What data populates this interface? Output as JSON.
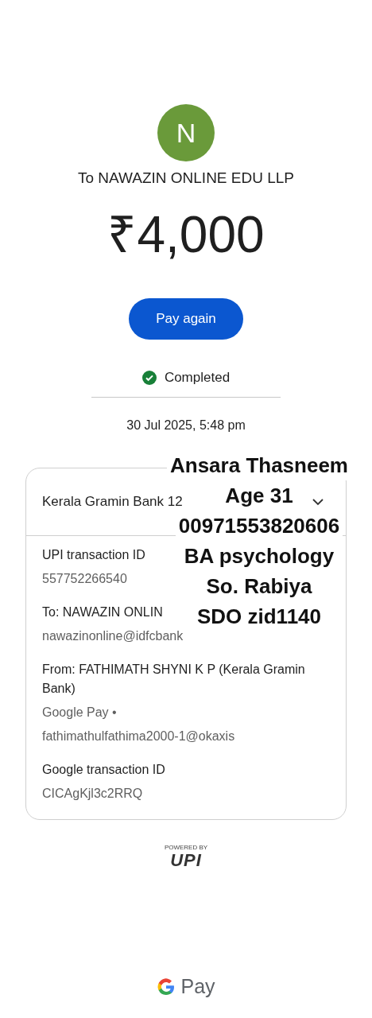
{
  "payee": {
    "initial": "N",
    "title": "To NAWAZIN ONLINE EDU LLP"
  },
  "amount": "₹4,000",
  "pay_again_button": "Pay again",
  "status": {
    "label": "Completed",
    "completed": true
  },
  "date": "30 Jul 2025, 5:48 pm",
  "details": {
    "bank": "Kerala Gramin Bank 12",
    "sections": [
      {
        "label": "UPI transaction ID",
        "values": [
          "557752266540"
        ]
      },
      {
        "label": "To: NAWAZIN ONLIN",
        "values": [
          "nawazinonline@idfcbank"
        ]
      },
      {
        "label": "From: FATHIMATH SHYNI K P (Kerala Gramin Bank)",
        "values": [
          "Google Pay •",
          "fathimathulfathima2000-1@okaxis"
        ]
      },
      {
        "label": "Google transaction ID",
        "values": [
          "CICAgKjl3c2RRQ"
        ]
      }
    ]
  },
  "upi_badge": {
    "caption": "POWERED BY",
    "logo": "UPI"
  },
  "footer_brand": "Pay",
  "note_overlay": [
    "Ansara Thasneem",
    "Age 31",
    "00971553820606",
    "BA psychology",
    "So. Rabiya",
    "SDO zid1140"
  ]
}
